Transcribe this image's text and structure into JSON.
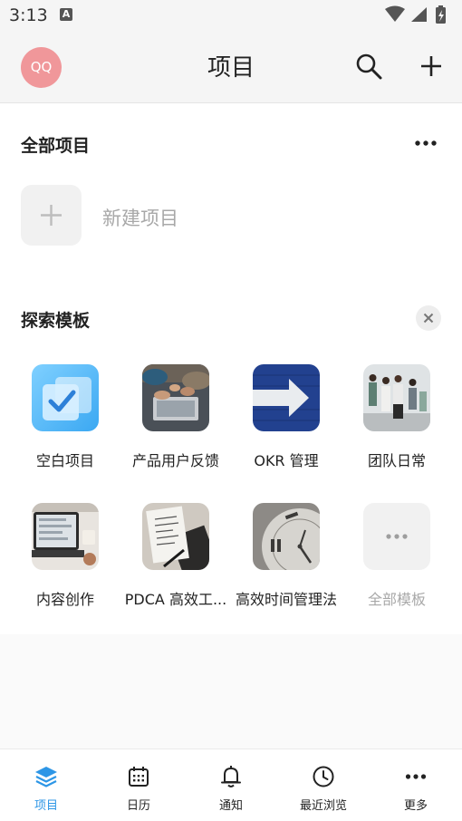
{
  "status_bar": {
    "time": "3:13",
    "notification_icon": "a-letter-icon"
  },
  "header": {
    "avatar_text": "QQ",
    "title": "项目"
  },
  "all_projects": {
    "title": "全部项目",
    "new_project_label": "新建项目"
  },
  "explore": {
    "title": "探索模板",
    "templates": [
      {
        "label": "空白项目",
        "icon": "blank-project-checkbox-icon"
      },
      {
        "label": "产品用户反馈",
        "icon": "laptop-hands-photo"
      },
      {
        "label": "OKR 管理",
        "icon": "arrow-on-blue-wall-photo"
      },
      {
        "label": "团队日常",
        "icon": "team-standing-photo"
      },
      {
        "label": "内容创作",
        "icon": "laptop-desk-photo"
      },
      {
        "label": "PDCA 高效工...",
        "icon": "notebook-pen-photo"
      },
      {
        "label": "高效时间管理法",
        "icon": "clock-face-photo"
      },
      {
        "label": "全部模板",
        "icon": "more-dots-icon"
      }
    ]
  },
  "bottom_nav": {
    "items": [
      {
        "label": "项目",
        "icon": "layers-icon",
        "active": true
      },
      {
        "label": "日历",
        "icon": "calendar-icon",
        "active": false
      },
      {
        "label": "通知",
        "icon": "bell-icon",
        "active": false
      },
      {
        "label": "最近浏览",
        "icon": "clock-icon",
        "active": false
      },
      {
        "label": "更多",
        "icon": "more-dots-icon",
        "active": false
      }
    ]
  },
  "colors": {
    "accent": "#2d96e6",
    "avatar_bg": "#f0979a",
    "muted_text": "#a8a8a8"
  }
}
